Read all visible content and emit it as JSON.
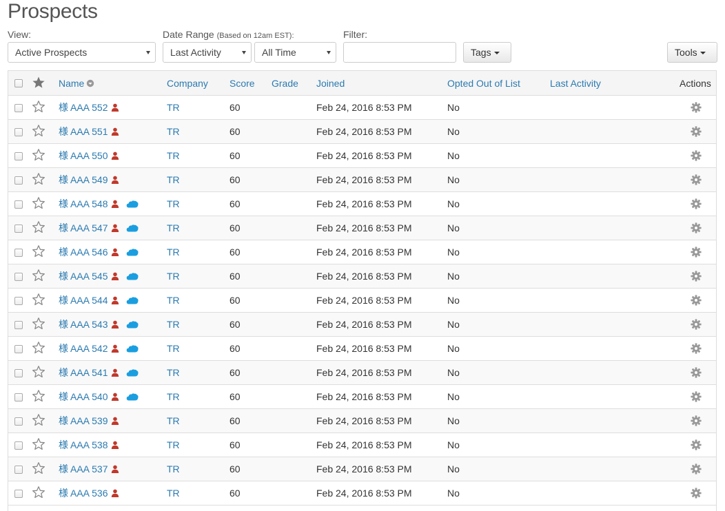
{
  "page": {
    "title": "Prospects"
  },
  "filters": {
    "view_label": "View:",
    "view_value": "Active Prospects",
    "date_range_label": "Date Range",
    "date_range_note": "(Based on 12am EST):",
    "date_activity_value": "Last Activity",
    "date_time_value": "All Time",
    "filter_label": "Filter:",
    "filter_value": "",
    "tags_label": "Tags",
    "tools_label": "Tools"
  },
  "table": {
    "columns": {
      "name": "Name",
      "company": "Company",
      "score": "Score",
      "grade": "Grade",
      "joined": "Joined",
      "opted_out": "Opted Out of List",
      "last_activity": "Last Activity",
      "actions": "Actions"
    },
    "rows": [
      {
        "kanji": "様",
        "name": "AAA 552",
        "company": "TR",
        "score": "60",
        "grade": "",
        "joined": "Feb 24, 2016 8:53 PM",
        "opted_out": "No",
        "last_activity": "",
        "crm": false
      },
      {
        "kanji": "様",
        "name": "AAA 551",
        "company": "TR",
        "score": "60",
        "grade": "",
        "joined": "Feb 24, 2016 8:53 PM",
        "opted_out": "No",
        "last_activity": "",
        "crm": false
      },
      {
        "kanji": "様",
        "name": "AAA 550",
        "company": "TR",
        "score": "60",
        "grade": "",
        "joined": "Feb 24, 2016 8:53 PM",
        "opted_out": "No",
        "last_activity": "",
        "crm": false
      },
      {
        "kanji": "様",
        "name": "AAA 549",
        "company": "TR",
        "score": "60",
        "grade": "",
        "joined": "Feb 24, 2016 8:53 PM",
        "opted_out": "No",
        "last_activity": "",
        "crm": false
      },
      {
        "kanji": "様",
        "name": "AAA 548",
        "company": "TR",
        "score": "60",
        "grade": "",
        "joined": "Feb 24, 2016 8:53 PM",
        "opted_out": "No",
        "last_activity": "",
        "crm": true
      },
      {
        "kanji": "様",
        "name": "AAA 547",
        "company": "TR",
        "score": "60",
        "grade": "",
        "joined": "Feb 24, 2016 8:53 PM",
        "opted_out": "No",
        "last_activity": "",
        "crm": true
      },
      {
        "kanji": "様",
        "name": "AAA 546",
        "company": "TR",
        "score": "60",
        "grade": "",
        "joined": "Feb 24, 2016 8:53 PM",
        "opted_out": "No",
        "last_activity": "",
        "crm": true
      },
      {
        "kanji": "様",
        "name": "AAA 545",
        "company": "TR",
        "score": "60",
        "grade": "",
        "joined": "Feb 24, 2016 8:53 PM",
        "opted_out": "No",
        "last_activity": "",
        "crm": true
      },
      {
        "kanji": "様",
        "name": "AAA 544",
        "company": "TR",
        "score": "60",
        "grade": "",
        "joined": "Feb 24, 2016 8:53 PM",
        "opted_out": "No",
        "last_activity": "",
        "crm": true
      },
      {
        "kanji": "様",
        "name": "AAA 543",
        "company": "TR",
        "score": "60",
        "grade": "",
        "joined": "Feb 24, 2016 8:53 PM",
        "opted_out": "No",
        "last_activity": "",
        "crm": true
      },
      {
        "kanji": "様",
        "name": "AAA 542",
        "company": "TR",
        "score": "60",
        "grade": "",
        "joined": "Feb 24, 2016 8:53 PM",
        "opted_out": "No",
        "last_activity": "",
        "crm": true
      },
      {
        "kanji": "様",
        "name": "AAA 541",
        "company": "TR",
        "score": "60",
        "grade": "",
        "joined": "Feb 24, 2016 8:53 PM",
        "opted_out": "No",
        "last_activity": "",
        "crm": true
      },
      {
        "kanji": "様",
        "name": "AAA 540",
        "company": "TR",
        "score": "60",
        "grade": "",
        "joined": "Feb 24, 2016 8:53 PM",
        "opted_out": "No",
        "last_activity": "",
        "crm": true
      },
      {
        "kanji": "様",
        "name": "AAA 539",
        "company": "TR",
        "score": "60",
        "grade": "",
        "joined": "Feb 24, 2016 8:53 PM",
        "opted_out": "No",
        "last_activity": "",
        "crm": false
      },
      {
        "kanji": "様",
        "name": "AAA 538",
        "company": "TR",
        "score": "60",
        "grade": "",
        "joined": "Feb 24, 2016 8:53 PM",
        "opted_out": "No",
        "last_activity": "",
        "crm": false
      },
      {
        "kanji": "様",
        "name": "AAA 537",
        "company": "TR",
        "score": "60",
        "grade": "",
        "joined": "Feb 24, 2016 8:53 PM",
        "opted_out": "No",
        "last_activity": "",
        "crm": false
      },
      {
        "kanji": "様",
        "name": "AAA 536",
        "company": "TR",
        "score": "60",
        "grade": "",
        "joined": "Feb 24, 2016 8:53 PM",
        "opted_out": "No",
        "last_activity": "",
        "crm": false
      }
    ]
  },
  "icons": {
    "person": "person-icon",
    "cloud": "salesforce-cloud-icon",
    "gear": "gear-icon",
    "star": "star-icon",
    "sort": "sort-icon"
  },
  "colors": {
    "link": "#2a7ab0",
    "person": "#c0392b",
    "cloud": "#1a9ee0",
    "gear": "#999999"
  }
}
